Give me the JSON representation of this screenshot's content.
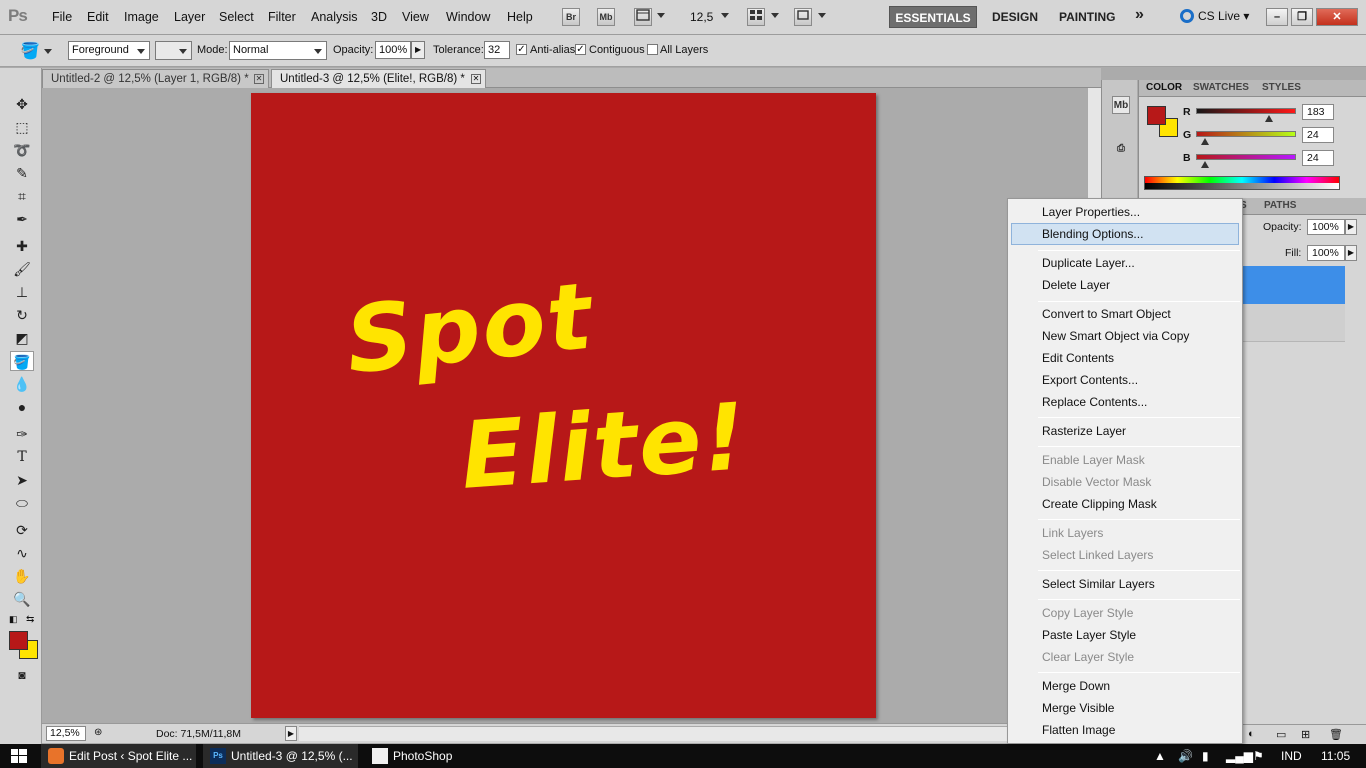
{
  "app": {
    "logo": "Ps"
  },
  "menu": {
    "items": [
      "File",
      "Edit",
      "Image",
      "Layer",
      "Select",
      "Filter",
      "Analysis",
      "3D",
      "View",
      "Window",
      "Help"
    ],
    "bridge_label": "Br",
    "minibridge_label": "Mb",
    "zoom": "12,5"
  },
  "workspaces": {
    "essentials": "ESSENTIALS",
    "design": "DESIGN",
    "painting": "PAINTING",
    "more": "»"
  },
  "cslive": "CS Live",
  "options": {
    "fill_source": "Foreground",
    "mode_label": "Mode:",
    "mode_value": "Normal",
    "opacity_label": "Opacity:",
    "opacity_value": "100%",
    "tolerance_label": "Tolerance:",
    "tolerance_value": "32",
    "antialias_label": "Anti-alias",
    "contiguous_label": "Contiguous",
    "all_layers_label": "All Layers"
  },
  "tabs": [
    {
      "label": "Untitled-2 @ 12,5% (Layer 1, RGB/8) *"
    },
    {
      "label": "Untitled-3 @ 12,5% (Elite!, RGB/8) *"
    }
  ],
  "artwork": {
    "line1": "Spot",
    "line2": "Elite!"
  },
  "status": {
    "zoom": "12,5%",
    "doc": "Doc: 71,5M/11,8M"
  },
  "color_panel": {
    "tabs": [
      "COLOR",
      "SWATCHES",
      "STYLES"
    ],
    "channels": [
      {
        "label": "R",
        "value": "183"
      },
      {
        "label": "G",
        "value": "24"
      },
      {
        "label": "B",
        "value": "24"
      }
    ],
    "foreground": "#b71818",
    "background": "#ffe400"
  },
  "layers_panel": {
    "tabs": [
      "S",
      "PATHS"
    ],
    "opacity_label": "Opacity:",
    "opacity_value": "100%",
    "fill_label": "Fill:",
    "fill_value": "100%"
  },
  "context_menu": {
    "items": [
      {
        "label": "Layer Properties...",
        "disabled": false
      },
      {
        "label": "Blending Options...",
        "disabled": false
      },
      {
        "label": "Duplicate Layer...",
        "disabled": false
      },
      {
        "label": "Delete Layer",
        "disabled": false
      },
      {
        "label": "Convert to Smart Object",
        "disabled": false
      },
      {
        "label": "New Smart Object via Copy",
        "disabled": false
      },
      {
        "label": "Edit Contents",
        "disabled": false
      },
      {
        "label": "Export Contents...",
        "disabled": false
      },
      {
        "label": "Replace Contents...",
        "disabled": false
      },
      {
        "label": "Rasterize Layer",
        "disabled": false
      },
      {
        "label": "Enable Layer Mask",
        "disabled": true
      },
      {
        "label": "Disable Vector Mask",
        "disabled": true
      },
      {
        "label": "Create Clipping Mask",
        "disabled": false
      },
      {
        "label": "Link Layers",
        "disabled": true
      },
      {
        "label": "Select Linked Layers",
        "disabled": true
      },
      {
        "label": "Select Similar Layers",
        "disabled": false
      },
      {
        "label": "Copy Layer Style",
        "disabled": true
      },
      {
        "label": "Paste Layer Style",
        "disabled": false
      },
      {
        "label": "Clear Layer Style",
        "disabled": true
      },
      {
        "label": "Merge Down",
        "disabled": false
      },
      {
        "label": "Merge Visible",
        "disabled": false
      },
      {
        "label": "Flatten Image",
        "disabled": false
      }
    ]
  },
  "taskbar": {
    "tasks": [
      {
        "label": "Edit Post ‹ Spot Elite ..."
      },
      {
        "label": "Untitled-3 @ 12,5% (..."
      },
      {
        "label": "PhotoShop"
      }
    ],
    "ps_icon_label": "Ps",
    "lang": "IND",
    "time": "11:05"
  }
}
